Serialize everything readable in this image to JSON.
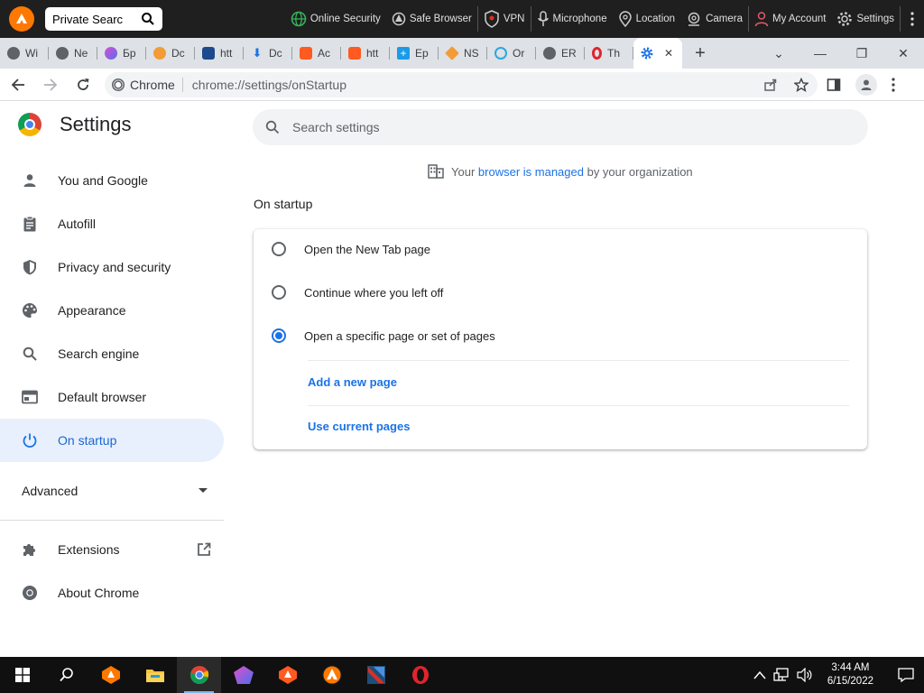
{
  "toolbar": {
    "search_text": "Private Searc",
    "items": [
      {
        "label": "Online Security",
        "icon": "globe-shield-icon"
      },
      {
        "label": "Safe Browser",
        "icon": "avast-browser-icon"
      },
      {
        "label": "VPN",
        "icon": "vpn-shield-icon"
      },
      {
        "label": "Microphone",
        "icon": "microphone-icon"
      },
      {
        "label": "Location",
        "icon": "location-pin-icon"
      },
      {
        "label": "Camera",
        "icon": "camera-icon"
      },
      {
        "label": "My Account",
        "icon": "user-icon"
      },
      {
        "label": "Settings",
        "icon": "gear-icon"
      }
    ]
  },
  "tabs": [
    {
      "label": "Wi",
      "icon": "chrome-gray-icon",
      "color": "#5f6368"
    },
    {
      "label": "Ne",
      "icon": "chrome-gray-icon",
      "color": "#5f6368"
    },
    {
      "label": "Бр",
      "icon": "polygon-icon",
      "color": "#8e5ce6"
    },
    {
      "label": "Dc",
      "icon": "avast-icon",
      "color": "#ff7800"
    },
    {
      "label": "htt",
      "icon": "bing-icon",
      "color": "#1c4a8c"
    },
    {
      "label": "Dc",
      "icon": "download-icon",
      "color": "#1a73e8"
    },
    {
      "label": "Ac",
      "icon": "avast-icon",
      "color": "#ff5a1f"
    },
    {
      "label": "htt",
      "icon": "avast-icon",
      "color": "#ff5a1f"
    },
    {
      "label": "Ep",
      "icon": "plus-box-icon",
      "color": "#1a9be8"
    },
    {
      "label": "NS",
      "icon": "diamond-icon",
      "color": "#f29c38"
    },
    {
      "label": "Or",
      "icon": "circle-icon",
      "color": "#2aa8e0"
    },
    {
      "label": "ER",
      "icon": "globe-icon",
      "color": "#5f6368"
    },
    {
      "label": "Th",
      "icon": "opera-icon",
      "color": "#e0242c"
    }
  ],
  "active_tab": {
    "icon": "gear-icon",
    "close": "✕"
  },
  "window_controls": {
    "dropdown": "⌄",
    "minimize": "—",
    "restore": "❐",
    "close": "✕"
  },
  "omnibox": {
    "chip": "Chrome",
    "url": "chrome://settings/onStartup"
  },
  "settings": {
    "title": "Settings",
    "search_placeholder": "Search settings",
    "managed_prefix": "Your",
    "managed_link": "browser is managed",
    "managed_suffix": "by your organization",
    "sidebar": [
      {
        "label": "You and Google",
        "icon": "person-icon"
      },
      {
        "label": "Autofill",
        "icon": "clipboard-icon"
      },
      {
        "label": "Privacy and security",
        "icon": "shield-icon"
      },
      {
        "label": "Appearance",
        "icon": "palette-icon"
      },
      {
        "label": "Search engine",
        "icon": "search-icon"
      },
      {
        "label": "Default browser",
        "icon": "browser-window-icon"
      },
      {
        "label": "On startup",
        "icon": "power-icon",
        "active": true
      }
    ],
    "advanced": "Advanced",
    "extensions": "Extensions",
    "about": "About Chrome",
    "section_title": "On startup",
    "options": [
      {
        "label": "Open the New Tab page",
        "checked": false
      },
      {
        "label": "Continue where you left off",
        "checked": false
      },
      {
        "label": "Open a specific page or set of pages",
        "checked": true
      }
    ],
    "add_page": "Add a new page",
    "use_current": "Use current pages"
  },
  "taskbar": {
    "time": "3:44 AM",
    "date": "6/15/2022",
    "apps": [
      "start-icon",
      "search-icon",
      "avast-browser-icon",
      "file-explorer-icon",
      "chrome-icon",
      "polygon-app-icon",
      "avast-secure-icon",
      "avast-app-icon",
      "red-app-icon",
      "opera-icon"
    ]
  },
  "colors": {
    "accent": "#1a73e8",
    "active_bg": "#e8f0fe",
    "avast_orange": "#ff7800"
  }
}
